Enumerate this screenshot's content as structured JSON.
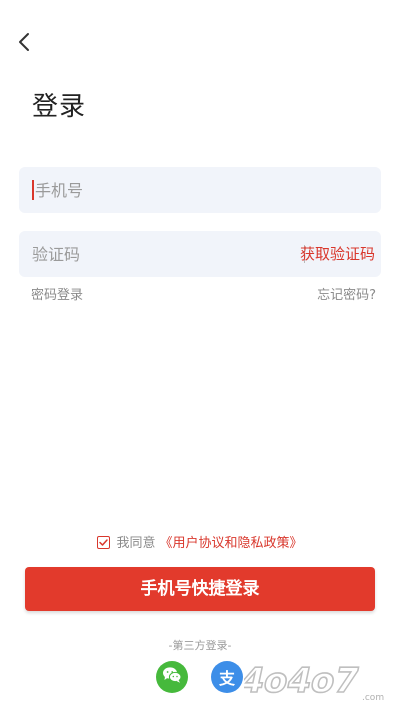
{
  "header": {
    "title": "登录"
  },
  "form": {
    "phone_placeholder": "手机号",
    "code_placeholder": "验证码",
    "get_code_label": "获取验证码",
    "password_login_label": "密码登录",
    "forgot_password_label": "忘记密码?"
  },
  "agreement": {
    "checked": true,
    "prefix": "我同意",
    "policy_link": "《用户协议和隐私政策》"
  },
  "actions": {
    "quick_login_label": "手机号快捷登录"
  },
  "third_party": {
    "label": "-第三方登录-",
    "providers": [
      {
        "name": "wechat",
        "icon": "wechat-icon",
        "color": "#46b93c"
      },
      {
        "name": "alipay",
        "icon": "alipay-icon",
        "glyph": "支",
        "color": "#3d8ee8"
      }
    ]
  },
  "watermark": {
    "text": "4o4o7.com"
  },
  "colors": {
    "accent": "#e23a2c",
    "field_bg": "#f1f4fa"
  }
}
